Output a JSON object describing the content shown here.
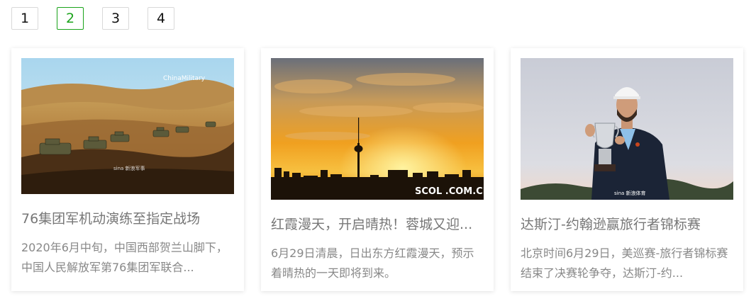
{
  "pagination": {
    "pages": [
      "1",
      "2",
      "3",
      "4"
    ],
    "current": "2"
  },
  "cards": [
    {
      "title": "76集团军机动演练至指定战场",
      "description": "2020年6月中旬，中国西部贺兰山脚下，中国人民解放军第76集团军联合...",
      "image_watermarks": [
        "ChinaMilitary",
        "sina 新浪军事"
      ]
    },
    {
      "title": "红霞漫天，开启晴热！蓉城又迎...",
      "description": "6月29日清晨，日出东方红霞漫天，预示着晴热的一天即将到来。",
      "image_watermarks": [
        "SCOL .COM.CN 四川在线"
      ]
    },
    {
      "title": "达斯汀-约翰逊赢旅行者锦标赛",
      "description": "北京时间6月29日，美巡赛-旅行者锦标赛结束了决赛轮争夺，达斯汀-约...",
      "image_watermarks": [
        "sina 新浪体育"
      ]
    }
  ],
  "colors": {
    "active_page": "#1aa31a",
    "title_text": "#777777",
    "desc_text": "#888888"
  }
}
